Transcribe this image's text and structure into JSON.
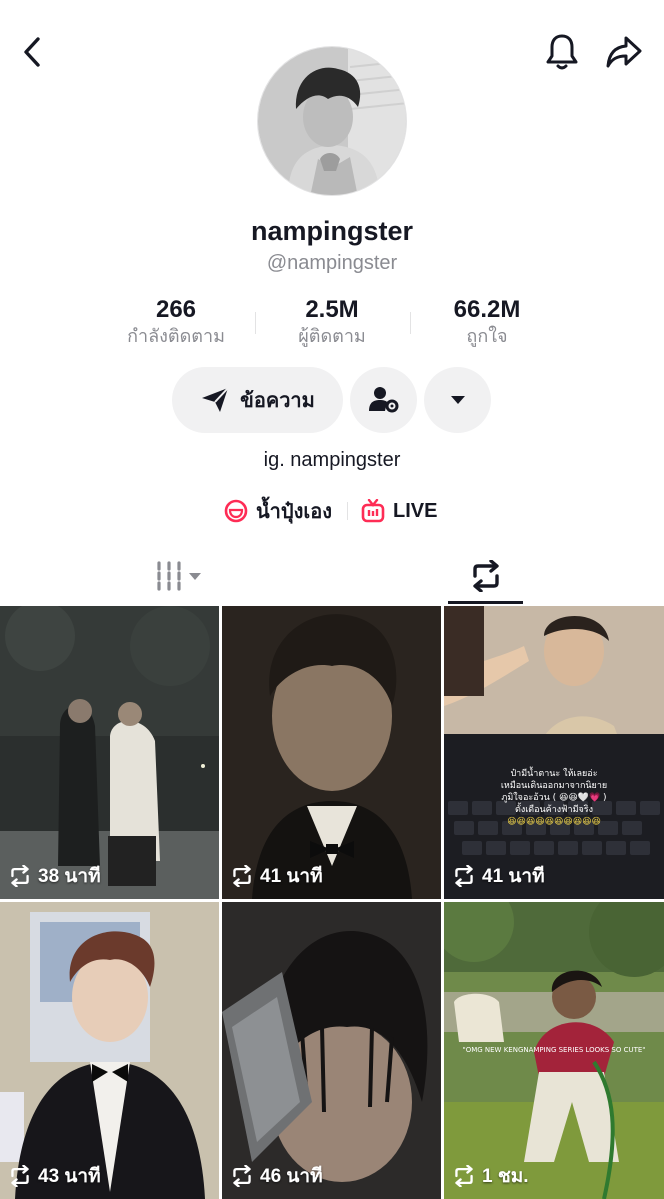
{
  "profile": {
    "display_name": "nampingster",
    "handle": "@nampingster",
    "bio": "ig. nampingster"
  },
  "stats": [
    {
      "value": "266",
      "label": "กำลังติดตาม"
    },
    {
      "value": "2.5M",
      "label": "ผู้ติดตาม"
    },
    {
      "value": "66.2M",
      "label": "ถูกใจ"
    }
  ],
  "actions": {
    "message_label": "ข้อความ"
  },
  "links": [
    {
      "label": "น้ำปุ๋งเอง",
      "icon": "lemon8-icon"
    },
    {
      "label": "LIVE",
      "icon": "live-tv-icon"
    }
  ],
  "icons": {
    "back": "chevron-left-icon",
    "notifications": "bell-icon",
    "share": "share-arrow-icon",
    "add_friend": "user-settings-icon",
    "more": "caret-down-icon",
    "videos_tab": "grid-icon",
    "reposts_tab": "repost-icon"
  },
  "colors": {
    "text": "#161823",
    "muted": "#8a8b91",
    "button_bg": "#f1f1f2",
    "accent": "#fe2c55"
  },
  "videos": [
    {
      "duration": "38 นาที"
    },
    {
      "duration": "41 นาที"
    },
    {
      "duration": "41 นาที",
      "overlay_text": [
        "ป๋ามีน้ำตานะ ให้เลยอ่ะ",
        "เหมือนเดินออกมาจากนิยาย",
        "ภูมิใจอะอ้วน ( 😆😆🤍💗 )",
        "ตั้งเดือนค้างฟ้ามีจริง",
        "😆😆😆😆😆😆😆😆😆😆"
      ]
    },
    {
      "duration": "43 นาที"
    },
    {
      "duration": "46 นาที"
    },
    {
      "duration": "1 ชม.",
      "overlay_text": [
        "\"OMG NEW KENGNAMPING SERIES LOOKS SO CUTE\""
      ]
    }
  ]
}
